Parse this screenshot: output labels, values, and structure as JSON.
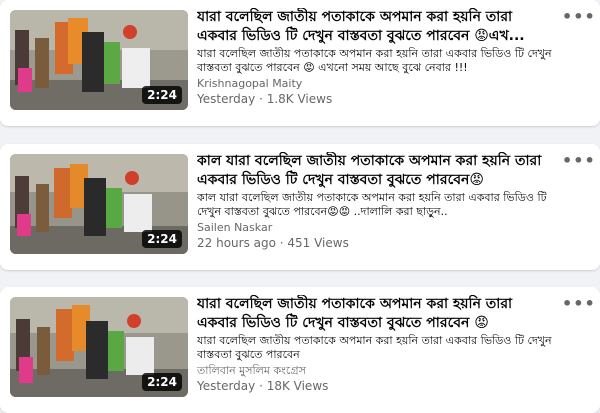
{
  "videos": [
    {
      "title": "যারা বলেছিল জাতীয় পতাকাকে অপমান করা হয়নি তারা একবার ভিডিও টি দেখুন বাস্তবতা বুঝতে পারবেন 😡এখ...",
      "description": "যারা বলেছিল জাতীয় পতাকাকে অপমান করা হয়নি তারা একবার ভিডিও টি দেখুন বাস্তবতা বুঝতে পারবেন 😡 এখনো সময় আছে বুঝে নেবার !!!",
      "author": "Krishnagopal Maity",
      "meta": "Yesterday · 1.8K Views",
      "duration": "2:24",
      "more_label": "•••"
    },
    {
      "title": "কাল যারা বলেছিল জাতীয় পতাকাকে অপমান করা হয়নি তারা একবার ভিডিও টি দেখুন বাস্তবতা বুঝতে পারবেন😡",
      "description": "কাল যারা বলেছিল জাতীয় পতাকাকে অপমান করা হয়নি তারা একবার ভিডিও টি দেখুন বাস্তবতা বুঝতে পারবেন😡😡 ..দালালি করা ছাড়ুন..",
      "author": "Sailen Naskar",
      "meta": "22 hours ago · 451 Views",
      "duration": "2:24",
      "more_label": "•••"
    },
    {
      "title": "যারা বলেছিল জাতীয় পতাকাকে অপমান করা হয়নি তারা একবার ভিডিও টি দেখুন বাস্তবতা বুঝতে পারবেন 😡",
      "description": "যারা বলেছিল জাতীয় পতাকাকে অপমান করা হয়নি তারা একবার ভিডিও টি দেখুন বাস্তবতা বুঝতে পারবেন",
      "author": "তালিবান মুসলিম কংগ্রেস",
      "meta": "Yesterday · 18K Views",
      "duration": "2:24",
      "more_label": "•••"
    }
  ]
}
